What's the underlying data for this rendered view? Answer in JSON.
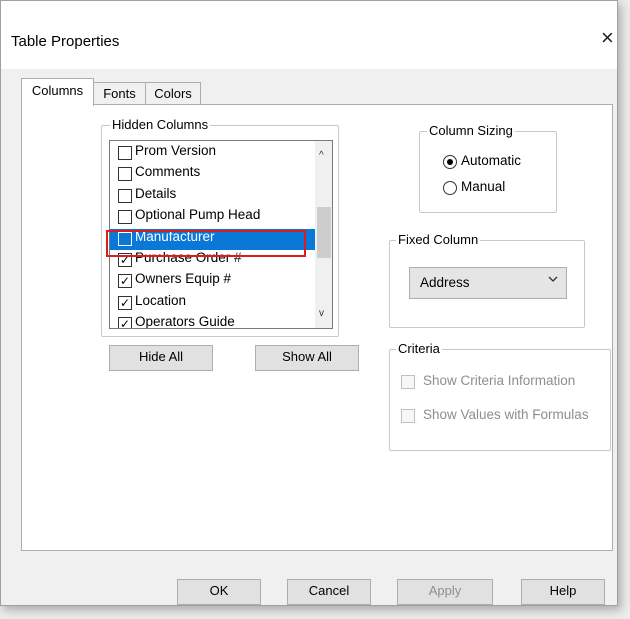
{
  "window": {
    "title": "Table Properties",
    "close_glyph": "×"
  },
  "tabs": [
    {
      "label": "Columns",
      "active": true
    },
    {
      "label": "Fonts",
      "active": false
    },
    {
      "label": "Colors",
      "active": false
    }
  ],
  "hidden_columns": {
    "label": "Hidden Columns",
    "items": [
      {
        "label": "Prom Version",
        "checked": false,
        "selected": false
      },
      {
        "label": "Comments",
        "checked": false,
        "selected": false
      },
      {
        "label": "Details",
        "checked": false,
        "selected": false
      },
      {
        "label": "Optional Pump Head",
        "checked": false,
        "selected": false
      },
      {
        "label": "Manufacturer",
        "checked": false,
        "selected": true
      },
      {
        "label": "Purchase Order #",
        "checked": true,
        "selected": false
      },
      {
        "label": "Owners Equip #",
        "checked": true,
        "selected": false
      },
      {
        "label": "Location",
        "checked": true,
        "selected": false
      },
      {
        "label": "Operators Guide",
        "checked": true,
        "selected": false
      }
    ],
    "hide_all_label": "Hide All",
    "show_all_label": "Show All"
  },
  "column_sizing": {
    "label": "Column Sizing",
    "automatic_label": "Automatic",
    "manual_label": "Manual",
    "selected": "Automatic"
  },
  "fixed_column": {
    "label": "Fixed Column",
    "value": "Address"
  },
  "criteria": {
    "label": "Criteria",
    "show_criteria_label": "Show Criteria Information",
    "show_values_label": "Show Values with Formulas"
  },
  "buttons": {
    "ok": "OK",
    "cancel": "Cancel",
    "apply": "Apply",
    "help": "Help"
  },
  "colors": {
    "selection": "#0a78d7",
    "highlight_border": "#d81e1e"
  },
  "icons": {
    "check": "✓",
    "scroll_up": "^",
    "scroll_down": "v",
    "dropdown": "chevron-down"
  }
}
